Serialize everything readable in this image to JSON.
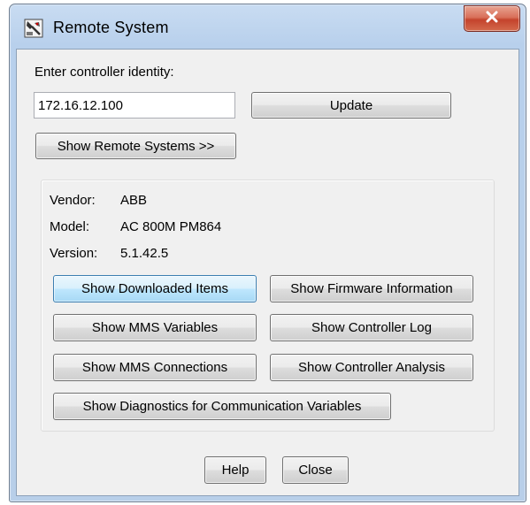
{
  "window": {
    "title": "Remote System",
    "app_icon": "remote-system-icon",
    "close_icon": "close-icon"
  },
  "identity": {
    "label": "Enter controller identity:",
    "value": "172.16.12.100",
    "update_label": "Update",
    "show_remote_label": "Show Remote Systems >>"
  },
  "info": {
    "vendor_label": "Vendor:",
    "vendor_value": "ABB",
    "model_label": "Model:",
    "model_value": "AC 800M PM864",
    "version_label": "Version:",
    "version_value": "5.1.42.5"
  },
  "actions": {
    "downloaded_items": "Show Downloaded Items",
    "firmware_info": "Show Firmware Information",
    "mms_variables": "Show MMS Variables",
    "controller_log": "Show Controller Log",
    "mms_connections": "Show MMS Connections",
    "controller_analysis": "Show Controller Analysis",
    "diagnostics": "Show Diagnostics for Communication Variables"
  },
  "footer": {
    "help_label": "Help",
    "close_label": "Close"
  },
  "colors": {
    "title_bar": "#c9dcf2",
    "close_button": "#c4432c",
    "focused_button": "#bee6fd",
    "dialog_background": "#f0f0f0"
  }
}
